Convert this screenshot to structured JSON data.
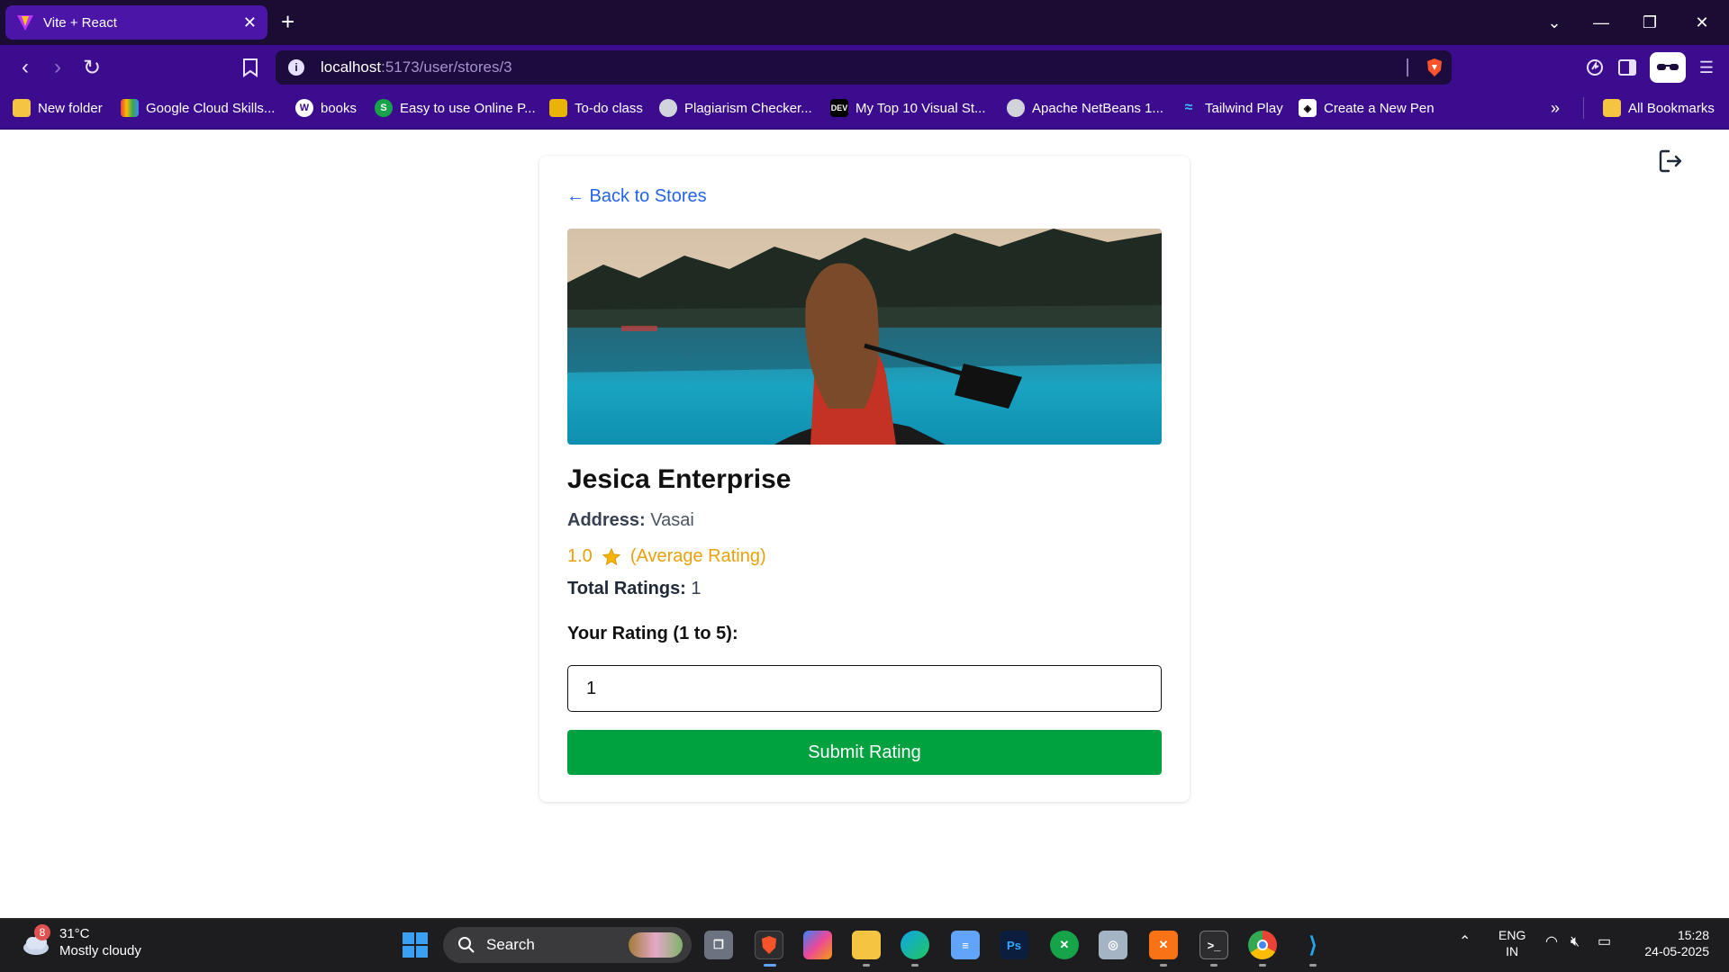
{
  "browser": {
    "tab_title": "Vite + React",
    "tab_close": "✕",
    "new_tab": "+",
    "url_host": "localhost",
    "url_path": ":5173/user/stores/3",
    "bookmarks": [
      {
        "label": "New folder",
        "icon": "folder-icon",
        "color": "#f5c542"
      },
      {
        "label": "Google Cloud Skills...",
        "icon": "google-cloud-icon",
        "color": "#4285f4"
      },
      {
        "label": "books",
        "icon": "wordpress-icon",
        "color": "#ffffff"
      },
      {
        "label": "Easy to use Online P...",
        "icon": "s-icon",
        "color": "#16a34a"
      },
      {
        "label": "To-do class",
        "icon": "todo-icon",
        "color": "#eab308"
      },
      {
        "label": "Plagiarism Checker...",
        "icon": "globe-icon",
        "color": "#d1d5db"
      },
      {
        "label": "My Top 10 Visual St...",
        "icon": "dev-icon",
        "color": "#000000"
      },
      {
        "label": "Apache NetBeans 1...",
        "icon": "globe-icon",
        "color": "#d1d5db"
      },
      {
        "label": "Tailwind Play",
        "icon": "tailwind-icon",
        "color": "#38bdf8"
      },
      {
        "label": "Create a New Pen",
        "icon": "codepen-icon",
        "color": "#ffffff"
      }
    ],
    "all_bookmarks": "All Bookmarks"
  },
  "page": {
    "back_link": "← Back to Stores",
    "store_name": "Jesica Enterprise",
    "address_label": "Address:",
    "address_value": "Vasai",
    "avg_rating_value": "1.0",
    "avg_rating_label": "(Average Rating)",
    "total_label": "Total Ratings:",
    "total_value": "1",
    "your_rating_label": "Your Rating (1 to 5):",
    "rating_input_value": "1",
    "submit_label": "Submit Rating",
    "accent_link": "#2563eb",
    "accent_submit": "#00a240",
    "accent_rating": "#e9a10b"
  },
  "taskbar": {
    "weather_badge": "8",
    "weather_temp": "31°C",
    "weather_desc": "Mostly cloudy",
    "search_label": "Search",
    "lang_line1": "ENG",
    "lang_line2": "IN",
    "time": "15:28",
    "date": "24-05-2025"
  }
}
